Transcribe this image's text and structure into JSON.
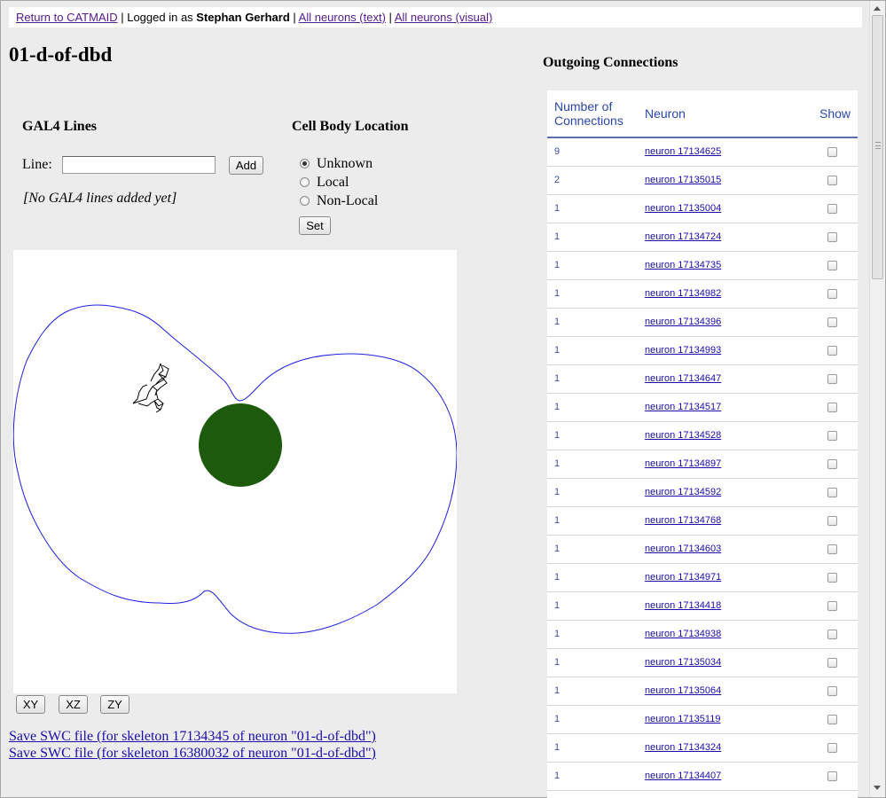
{
  "topbar": {
    "return_link": "Return to CATMAID",
    "sep1": " | Logged in as ",
    "user": "Stephan Gerhard",
    "sep2": " | ",
    "all_text_link": "All neurons (text)",
    "sep3": " | ",
    "all_visual_link": "All neurons (visual)"
  },
  "page_title": "01-d-of-dbd",
  "gal4": {
    "heading": "GAL4 Lines",
    "line_label": "Line:",
    "line_value": "",
    "add_label": "Add",
    "empty_text": "[No GAL4 lines added yet]"
  },
  "cell_body": {
    "heading": "Cell Body Location",
    "options": [
      "Unknown",
      "Local",
      "Non-Local"
    ],
    "selected": "Unknown",
    "set_label": "Set"
  },
  "viewer": {
    "outline_color": "#1f1fe0",
    "soma_color": "#1e5a0c",
    "skeleton_color": "#000000",
    "view_buttons": [
      "XY",
      "XZ",
      "ZY"
    ]
  },
  "swc_links": [
    "Save SWC file (for skeleton 17134345 of neuron \"01-d-of-dbd\")",
    "Save SWC file (for skeleton 16380032 of neuron \"01-d-of-dbd\")"
  ],
  "outgoing": {
    "heading": "Outgoing Connections",
    "columns": [
      "Number of Connections",
      "Neuron",
      "Show"
    ],
    "rows": [
      {
        "count": "9",
        "neuron": "neuron 17134625"
      },
      {
        "count": "2",
        "neuron": "neuron 17135015"
      },
      {
        "count": "1",
        "neuron": "neuron 17135004"
      },
      {
        "count": "1",
        "neuron": "neuron 17134724"
      },
      {
        "count": "1",
        "neuron": "neuron 17134735"
      },
      {
        "count": "1",
        "neuron": "neuron 17134982"
      },
      {
        "count": "1",
        "neuron": "neuron 17134396"
      },
      {
        "count": "1",
        "neuron": "neuron 17134993"
      },
      {
        "count": "1",
        "neuron": "neuron 17134647"
      },
      {
        "count": "1",
        "neuron": "neuron 17134517"
      },
      {
        "count": "1",
        "neuron": "neuron 17134528"
      },
      {
        "count": "1",
        "neuron": "neuron 17134897"
      },
      {
        "count": "1",
        "neuron": "neuron 17134592"
      },
      {
        "count": "1",
        "neuron": "neuron 17134768"
      },
      {
        "count": "1",
        "neuron": "neuron 17134603"
      },
      {
        "count": "1",
        "neuron": "neuron 17134971"
      },
      {
        "count": "1",
        "neuron": "neuron 17134418"
      },
      {
        "count": "1",
        "neuron": "neuron 17134938"
      },
      {
        "count": "1",
        "neuron": "neuron 17135034"
      },
      {
        "count": "1",
        "neuron": "neuron 17135064"
      },
      {
        "count": "1",
        "neuron": "neuron 17135119"
      },
      {
        "count": "1",
        "neuron": "neuron 17134324"
      },
      {
        "count": "1",
        "neuron": "neuron 17134407"
      }
    ]
  }
}
